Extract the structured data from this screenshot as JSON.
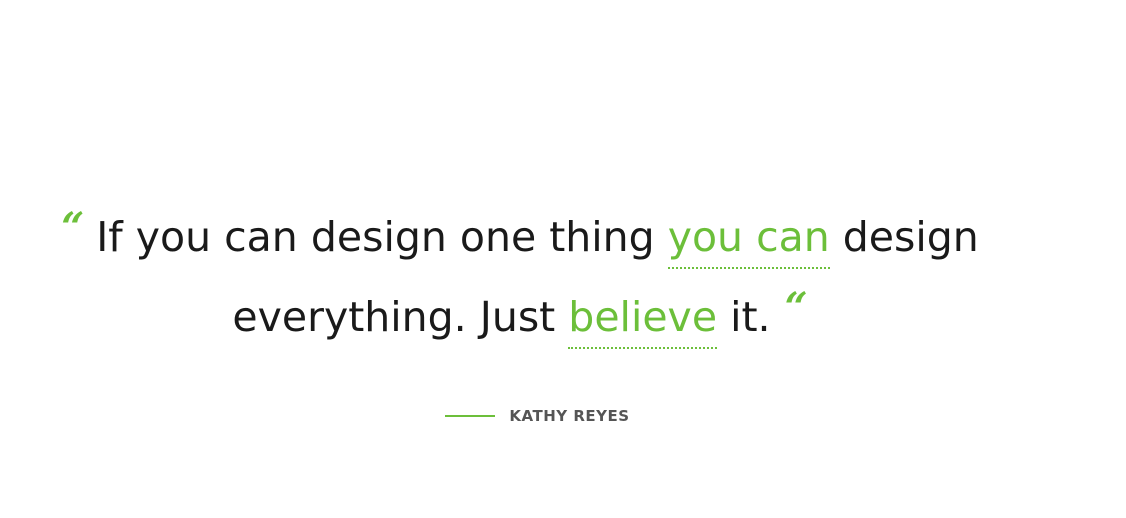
{
  "quote": {
    "open_mark": "“",
    "line1_before": "If you can design one thing ",
    "line1_highlight": "you can",
    "line1_after": " design",
    "line2_before": "everything. Just ",
    "line2_highlight": "believe",
    "line2_after": " it.",
    "close_mark": "“"
  },
  "author": {
    "name": "KATHY REYES"
  },
  "colors": {
    "accent": "#6cbf3a",
    "text": "#1a1a1a",
    "author_text": "#555555",
    "background": "#ffffff"
  }
}
